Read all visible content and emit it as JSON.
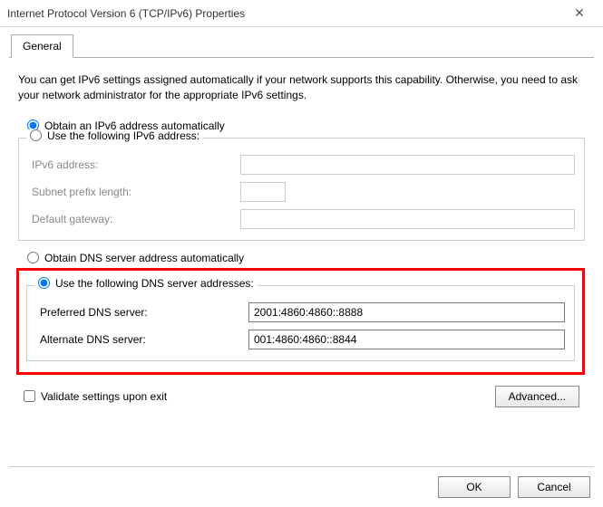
{
  "window": {
    "title": "Internet Protocol Version 6 (TCP/IPv6) Properties"
  },
  "tabs": {
    "general": "General"
  },
  "description": "You can get IPv6 settings assigned automatically if your network supports this capability. Otherwise, you need to ask your network administrator for the appropriate IPv6 settings.",
  "ip": {
    "auto_label": "Obtain an IPv6 address automatically",
    "manual_label": "Use the following IPv6 address:",
    "addr_label": "IPv6 address:",
    "prefix_label": "Subnet prefix length:",
    "gateway_label": "Default gateway:",
    "addr_value": "",
    "prefix_value": "",
    "gateway_value": ""
  },
  "dns": {
    "auto_label": "Obtain DNS server address automatically",
    "manual_label": "Use the following DNS server addresses:",
    "preferred_label": "Preferred DNS server:",
    "alternate_label": "Alternate DNS server:",
    "preferred_value": "2001:4860:4860::8888",
    "alternate_value": "001:4860:4860::8844"
  },
  "validate_label": "Validate settings upon exit",
  "buttons": {
    "advanced": "Advanced...",
    "ok": "OK",
    "cancel": "Cancel"
  }
}
